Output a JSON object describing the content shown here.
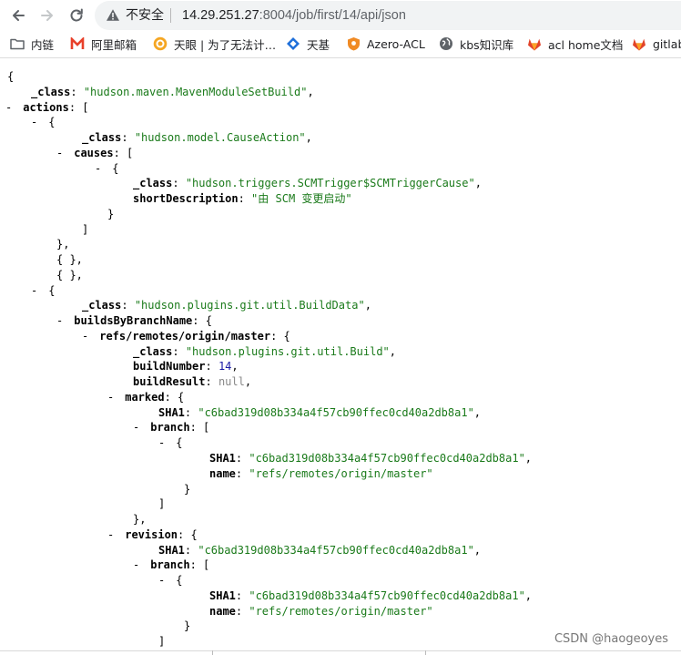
{
  "browser": {
    "security_label": "不安全",
    "url_host": "14.29.251.27",
    "url_path": ":8004/job/first/14/api/json"
  },
  "bookmarks": [
    {
      "label": "内链",
      "icon": "folder-icon"
    },
    {
      "label": "阿里邮箱",
      "icon": "aliyun-mail-icon"
    },
    {
      "label": "天眼 | 为了无法计…",
      "icon": "tianyan-icon"
    },
    {
      "label": "天基",
      "icon": "tianji-icon"
    },
    {
      "label": "Azero-ACL",
      "icon": "shield-icon"
    },
    {
      "label": "kbs知识库",
      "icon": "globe-icon"
    },
    {
      "label": "acl home文档",
      "icon": "gitlab-icon"
    },
    {
      "label": "gitlab",
      "icon": "gitlab-icon"
    }
  ],
  "json_lines": [
    {
      "toggle": "",
      "key": "",
      "value": "",
      "vtype": "",
      "punct": "{"
    },
    {
      "toggle": "",
      "key": "_class",
      "value": "\"hudson.maven.MavenModuleSetBuild\"",
      "vtype": "s",
      "punct": ","
    },
    {
      "toggle": "-",
      "key": "actions",
      "value": "",
      "vtype": "",
      "punct": " ["
    },
    {
      "toggle": "-",
      "key": "",
      "value": "",
      "vtype": "",
      "punct": "{"
    },
    {
      "toggle": "",
      "key": "_class",
      "value": "\"hudson.model.CauseAction\"",
      "vtype": "s",
      "punct": ","
    },
    {
      "toggle": "-",
      "key": "causes",
      "value": "",
      "vtype": "",
      "punct": " ["
    },
    {
      "toggle": "-",
      "key": "",
      "value": "",
      "vtype": "",
      "punct": "{"
    },
    {
      "toggle": "",
      "key": "_class",
      "value": "\"hudson.triggers.SCMTrigger$SCMTriggerCause\"",
      "vtype": "s",
      "punct": ","
    },
    {
      "toggle": "",
      "key": "shortDescription",
      "value": "\"由 SCM 变更启动\"",
      "vtype": "s",
      "punct": ""
    },
    {
      "toggle": "",
      "key": "",
      "value": "",
      "vtype": "",
      "punct": "}"
    },
    {
      "toggle": "",
      "key": "",
      "value": "",
      "vtype": "",
      "punct": "]"
    },
    {
      "toggle": "",
      "key": "",
      "value": "",
      "vtype": "",
      "punct": "},"
    },
    {
      "toggle": "",
      "key": "",
      "value": "",
      "vtype": "",
      "punct": "{ },"
    },
    {
      "toggle": "",
      "key": "",
      "value": "",
      "vtype": "",
      "punct": "{ },"
    },
    {
      "toggle": "-",
      "key": "",
      "value": "",
      "vtype": "",
      "punct": "{"
    },
    {
      "toggle": "",
      "key": "_class",
      "value": "\"hudson.plugins.git.util.BuildData\"",
      "vtype": "s",
      "punct": ","
    },
    {
      "toggle": "-",
      "key": "buildsByBranchName",
      "value": "",
      "vtype": "",
      "punct": " {"
    },
    {
      "toggle": "-",
      "key": "refs/remotes/origin/master",
      "value": "",
      "vtype": "",
      "punct": " {"
    },
    {
      "toggle": "",
      "key": "_class",
      "value": "\"hudson.plugins.git.util.Build\"",
      "vtype": "s",
      "punct": ","
    },
    {
      "toggle": "",
      "key": "buildNumber",
      "value": "14",
      "vtype": "n",
      "punct": ","
    },
    {
      "toggle": "",
      "key": "buildResult",
      "value": "null",
      "vtype": "nl",
      "punct": ","
    },
    {
      "toggle": "-",
      "key": "marked",
      "value": "",
      "vtype": "",
      "punct": " {"
    },
    {
      "toggle": "",
      "key": "SHA1",
      "value": "\"c6bad319d08b334a4f57cb90ffec0cd40a2db8a1\"",
      "vtype": "s",
      "punct": ","
    },
    {
      "toggle": "-",
      "key": "branch",
      "value": "",
      "vtype": "",
      "punct": " ["
    },
    {
      "toggle": "-",
      "key": "",
      "value": "",
      "vtype": "",
      "punct": "{"
    },
    {
      "toggle": "",
      "key": "SHA1",
      "value": "\"c6bad319d08b334a4f57cb90ffec0cd40a2db8a1\"",
      "vtype": "s",
      "punct": ","
    },
    {
      "toggle": "",
      "key": "name",
      "value": "\"refs/remotes/origin/master\"",
      "vtype": "s",
      "punct": ""
    },
    {
      "toggle": "",
      "key": "",
      "value": "",
      "vtype": "",
      "punct": "}"
    },
    {
      "toggle": "",
      "key": "",
      "value": "",
      "vtype": "",
      "punct": "]"
    },
    {
      "toggle": "",
      "key": "",
      "value": "",
      "vtype": "",
      "punct": "},"
    },
    {
      "toggle": "-",
      "key": "revision",
      "value": "",
      "vtype": "",
      "punct": " {"
    },
    {
      "toggle": "",
      "key": "SHA1",
      "value": "\"c6bad319d08b334a4f57cb90ffec0cd40a2db8a1\"",
      "vtype": "s",
      "punct": ","
    },
    {
      "toggle": "-",
      "key": "branch",
      "value": "",
      "vtype": "",
      "punct": " ["
    },
    {
      "toggle": "-",
      "key": "",
      "value": "",
      "vtype": "",
      "punct": "{"
    },
    {
      "toggle": "",
      "key": "SHA1",
      "value": "\"c6bad319d08b334a4f57cb90ffec0cd40a2db8a1\"",
      "vtype": "s",
      "punct": ","
    },
    {
      "toggle": "",
      "key": "name",
      "value": "\"refs/remotes/origin/master\"",
      "vtype": "s",
      "punct": ""
    },
    {
      "toggle": "",
      "key": "",
      "value": "",
      "vtype": "",
      "punct": "}"
    },
    {
      "toggle": "",
      "key": "",
      "value": "",
      "vtype": "",
      "punct": "]"
    }
  ],
  "watermark": "CSDN @haogeoyes",
  "colors": {
    "string": "#1a7a1a",
    "number": "#1a1aa6",
    "null": "#888888",
    "omnibox_bg": "#f1f3f4"
  }
}
